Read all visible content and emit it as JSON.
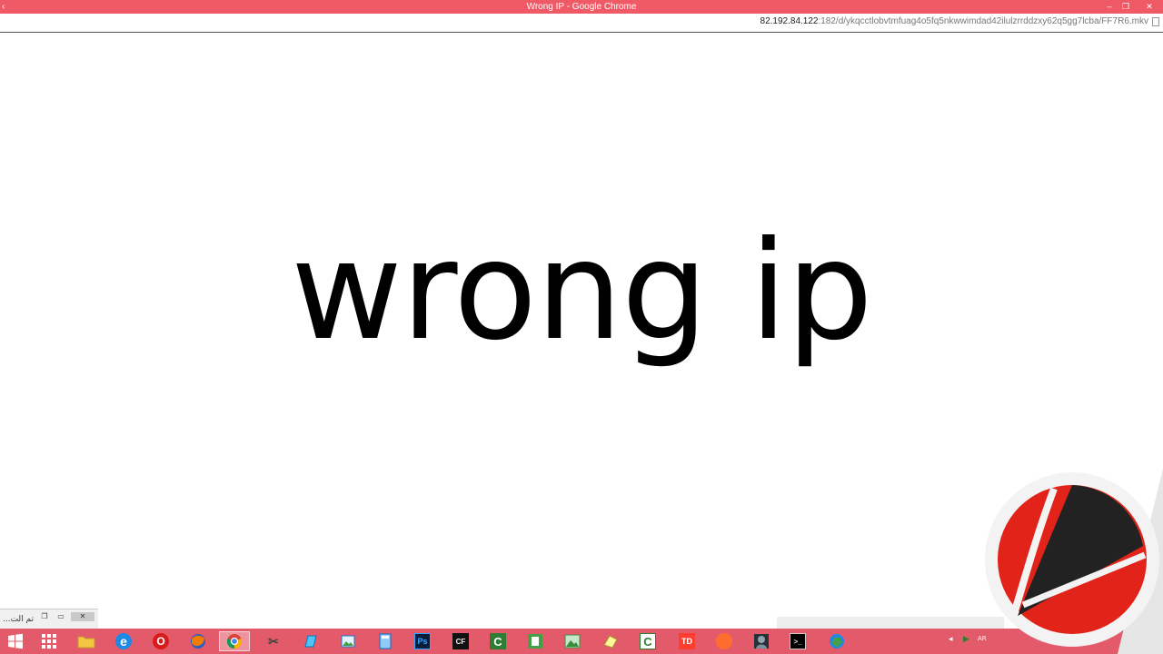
{
  "window": {
    "title": "Wrong IP - Google Chrome",
    "back_glyph": "‹",
    "minimize_glyph": "–",
    "restore_glyph": "❐",
    "close_glyph": "✕"
  },
  "address": {
    "host": "82.192.84.122",
    "path": ":182/d/ykqcctlobvtmfuag4o5fq5nkwwimdad42ilulzrrddzxy62q5gg7lcba/FF7R6.mkv"
  },
  "page": {
    "heading": "wrong ip"
  },
  "minimized_window": {
    "label": "...تم الت",
    "restore_glyph": "❐",
    "maximize_glyph": "▭",
    "close_glyph": "✕"
  },
  "taskbar": {
    "items": [
      {
        "name": "start",
        "glyph": ""
      },
      {
        "name": "apps",
        "glyph": ""
      },
      {
        "name": "file-explorer",
        "glyph": ""
      },
      {
        "name": "internet-explorer",
        "glyph": "e"
      },
      {
        "name": "opera",
        "glyph": "O"
      },
      {
        "name": "firefox",
        "glyph": ""
      },
      {
        "name": "chrome",
        "glyph": ""
      },
      {
        "name": "snipping-tool",
        "glyph": "✂"
      },
      {
        "name": "notes",
        "glyph": ""
      },
      {
        "name": "photos",
        "glyph": ""
      },
      {
        "name": "calculator",
        "glyph": ""
      },
      {
        "name": "photoshop",
        "glyph": "Ps"
      },
      {
        "name": "crossfire",
        "glyph": "CF"
      },
      {
        "name": "camtasia",
        "glyph": "C"
      },
      {
        "name": "green-app",
        "glyph": ""
      },
      {
        "name": "image-app",
        "glyph": ""
      },
      {
        "name": "folder-app",
        "glyph": ""
      },
      {
        "name": "camtasia-recorder",
        "glyph": "C"
      },
      {
        "name": "td-app",
        "glyph": "TD"
      },
      {
        "name": "orange-app",
        "glyph": ""
      },
      {
        "name": "soldier-app",
        "glyph": ""
      },
      {
        "name": "command-prompt",
        "glyph": ">_"
      },
      {
        "name": "download-manager",
        "glyph": ""
      }
    ],
    "tray": {
      "arrow": "◂",
      "play": "▶",
      "lang": "AR"
    }
  },
  "colors": {
    "titlebar": "#f05a66",
    "taskbar": "#e35b6b",
    "logo_red": "#e2231a",
    "logo_black": "#222222"
  }
}
